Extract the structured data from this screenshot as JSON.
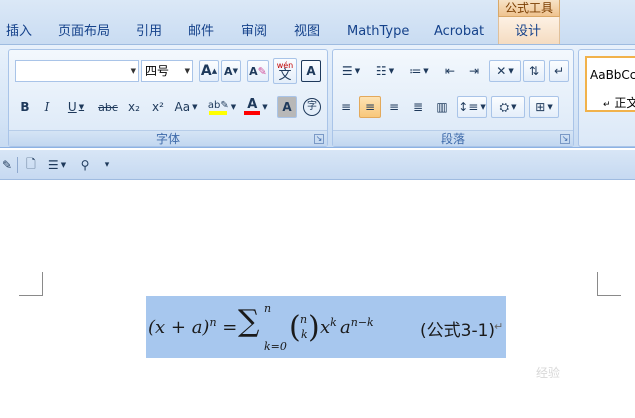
{
  "ribbon_tabs": {
    "insert": "插入",
    "page_layout": "页面布局",
    "references": "引用",
    "mailings": "邮件",
    "review": "审阅",
    "view": "视图",
    "mathtype": "MathType",
    "acrobat": "Acrobat",
    "design": "设计"
  },
  "contextual_header": "公式工具",
  "font_group": {
    "label": "字体",
    "font_name": "",
    "font_size": "四号",
    "grow": "A",
    "shrink": "A",
    "bold": "B",
    "italic": "I",
    "underline": "U",
    "strike": "abc",
    "subscript": "x₂",
    "superscript": "x²",
    "change_case": "Aa",
    "font_color": "A",
    "char_shading": "A",
    "enclose": "字",
    "phonetic": "wén",
    "phonetic_sub": "文",
    "char_border": "A",
    "clear": "A"
  },
  "paragraph_group": {
    "label": "段落"
  },
  "styles_group": {
    "preview": "AaBbCcI",
    "style_name": "正文"
  },
  "equation": {
    "lhs_open": "(x + a)",
    "lhs_exp": "n",
    "eq": " = ",
    "sum": "∑",
    "sum_top": "n",
    "sum_bottom": "k=0",
    "binom_top": "n",
    "binom_bottom": "k",
    "x": "x",
    "x_exp": "k",
    "a": "a",
    "a_exp": "n−k",
    "label": "(公式3-1)",
    "para_mark": "↵"
  },
  "watermark": "经验",
  "colors": {
    "ribbon_tab": "#dbe8f7",
    "selection": "#a7c7ee",
    "contextual": "#f5dcc1",
    "highlight_yellow": "#ffff00",
    "font_red": "#ff0000"
  }
}
